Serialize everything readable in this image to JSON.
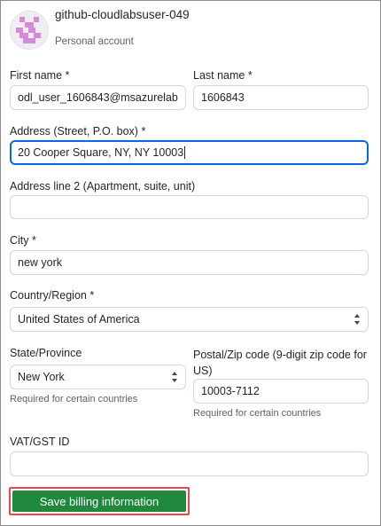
{
  "account": {
    "username": "github-cloudlabsuser-049",
    "type": "Personal account"
  },
  "form": {
    "first_name": {
      "label": "First name *",
      "value": "odl_user_1606843@msazurelab"
    },
    "last_name": {
      "label": "Last name *",
      "value": "1606843"
    },
    "address": {
      "label": "Address (Street, P.O. box) *",
      "value": "20 Cooper Square, NY, NY 10003"
    },
    "address2": {
      "label": "Address line 2 (Apartment, suite, unit)",
      "value": ""
    },
    "city": {
      "label": "City *",
      "value": "new york"
    },
    "country": {
      "label": "Country/Region *",
      "value": "United States of America"
    },
    "state": {
      "label": "State/Province",
      "value": "New York",
      "hint": "Required for certain countries"
    },
    "postal": {
      "label": "Postal/Zip code (9-digit zip code for US)",
      "value": "10003-7112",
      "hint": "Required for certain countries"
    },
    "vat": {
      "label": "VAT/GST ID",
      "value": ""
    },
    "save_label": "Save billing information"
  },
  "colors": {
    "focus_border": "#0969da",
    "button_bg": "#1f883d",
    "highlight_outline": "#e5484d",
    "avatar_pattern": "#d48bd6"
  }
}
